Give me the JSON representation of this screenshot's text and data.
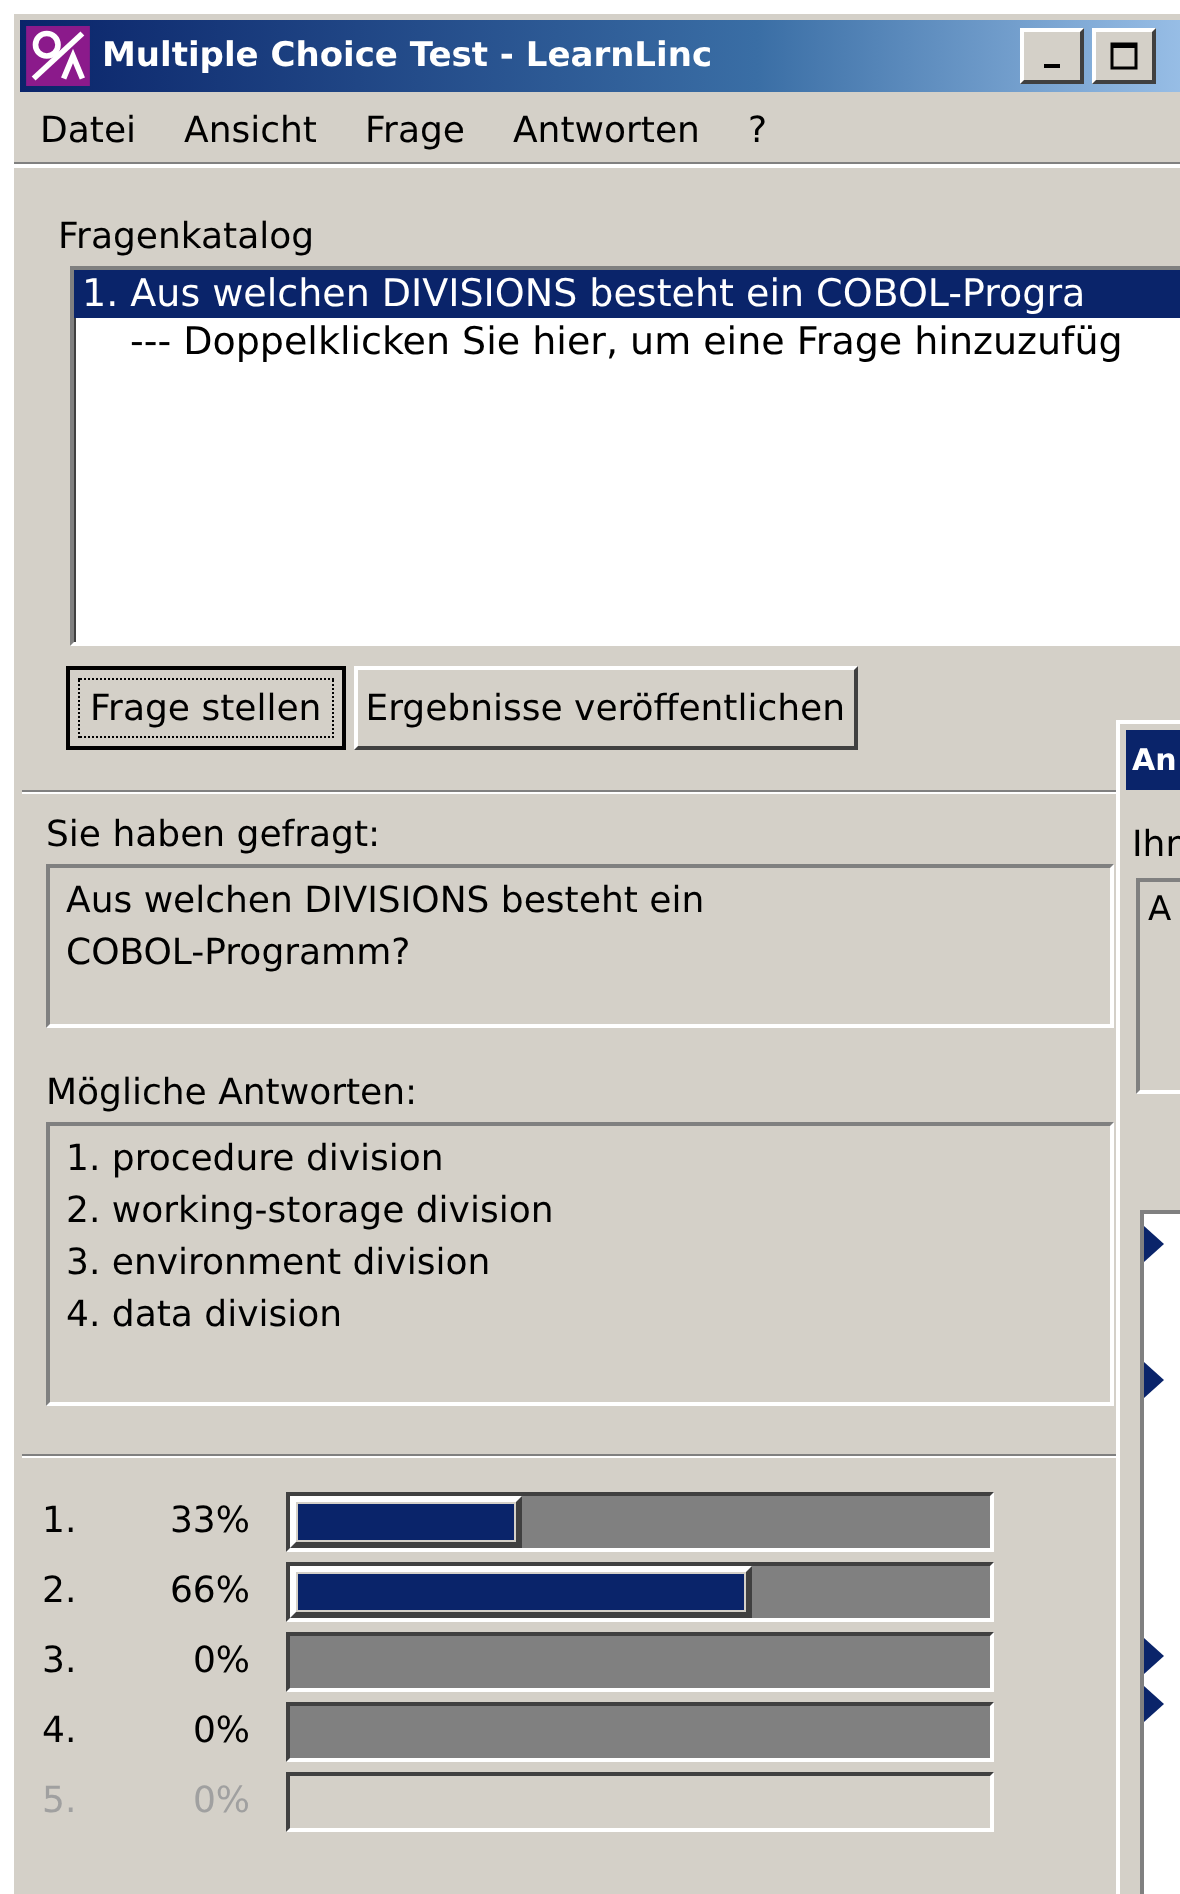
{
  "window": {
    "title": "Multiple Choice Test - LearnLinc"
  },
  "menu": [
    {
      "label": "Datei"
    },
    {
      "label": "Ansicht"
    },
    {
      "label": "Frage"
    },
    {
      "label": "Antworten"
    },
    {
      "label": "?"
    }
  ],
  "catalog": {
    "label": "Fragenkatalog",
    "items": [
      {
        "text": "1. Aus welchen DIVISIONS besteht ein COBOL-Progra",
        "selected": true
      },
      {
        "text": "--- Doppelklicken Sie hier, um eine Frage hinzuzufüg",
        "selected": false
      }
    ]
  },
  "buttons": [
    {
      "label": "Frage stellen",
      "focused": true
    },
    {
      "label": "Ergebnisse veröffentlichen",
      "focused": false
    }
  ],
  "asked": {
    "label": "Sie haben gefragt:",
    "text": "Aus welchen DIVISIONS besteht ein COBOL-Programm?"
  },
  "answers": {
    "label": "Mögliche Antworten:",
    "items": [
      "1. procedure division",
      "2. working-storage division",
      "3. environment division",
      "4. data division"
    ]
  },
  "results": [
    {
      "number": "1.",
      "percent": "33%",
      "level": 0.33,
      "disabled": false
    },
    {
      "number": "2.",
      "percent": "66%",
      "level": 0.66,
      "disabled": false
    },
    {
      "number": "3.",
      "percent": "0%",
      "level": 0,
      "disabled": false
    },
    {
      "number": "4.",
      "percent": "0%",
      "level": 0,
      "disabled": false
    },
    {
      "number": "5.",
      "percent": "0%",
      "level": 0,
      "disabled": true
    }
  ],
  "second_window": {
    "title": "An",
    "label": "Ihr",
    "text": "A"
  }
}
